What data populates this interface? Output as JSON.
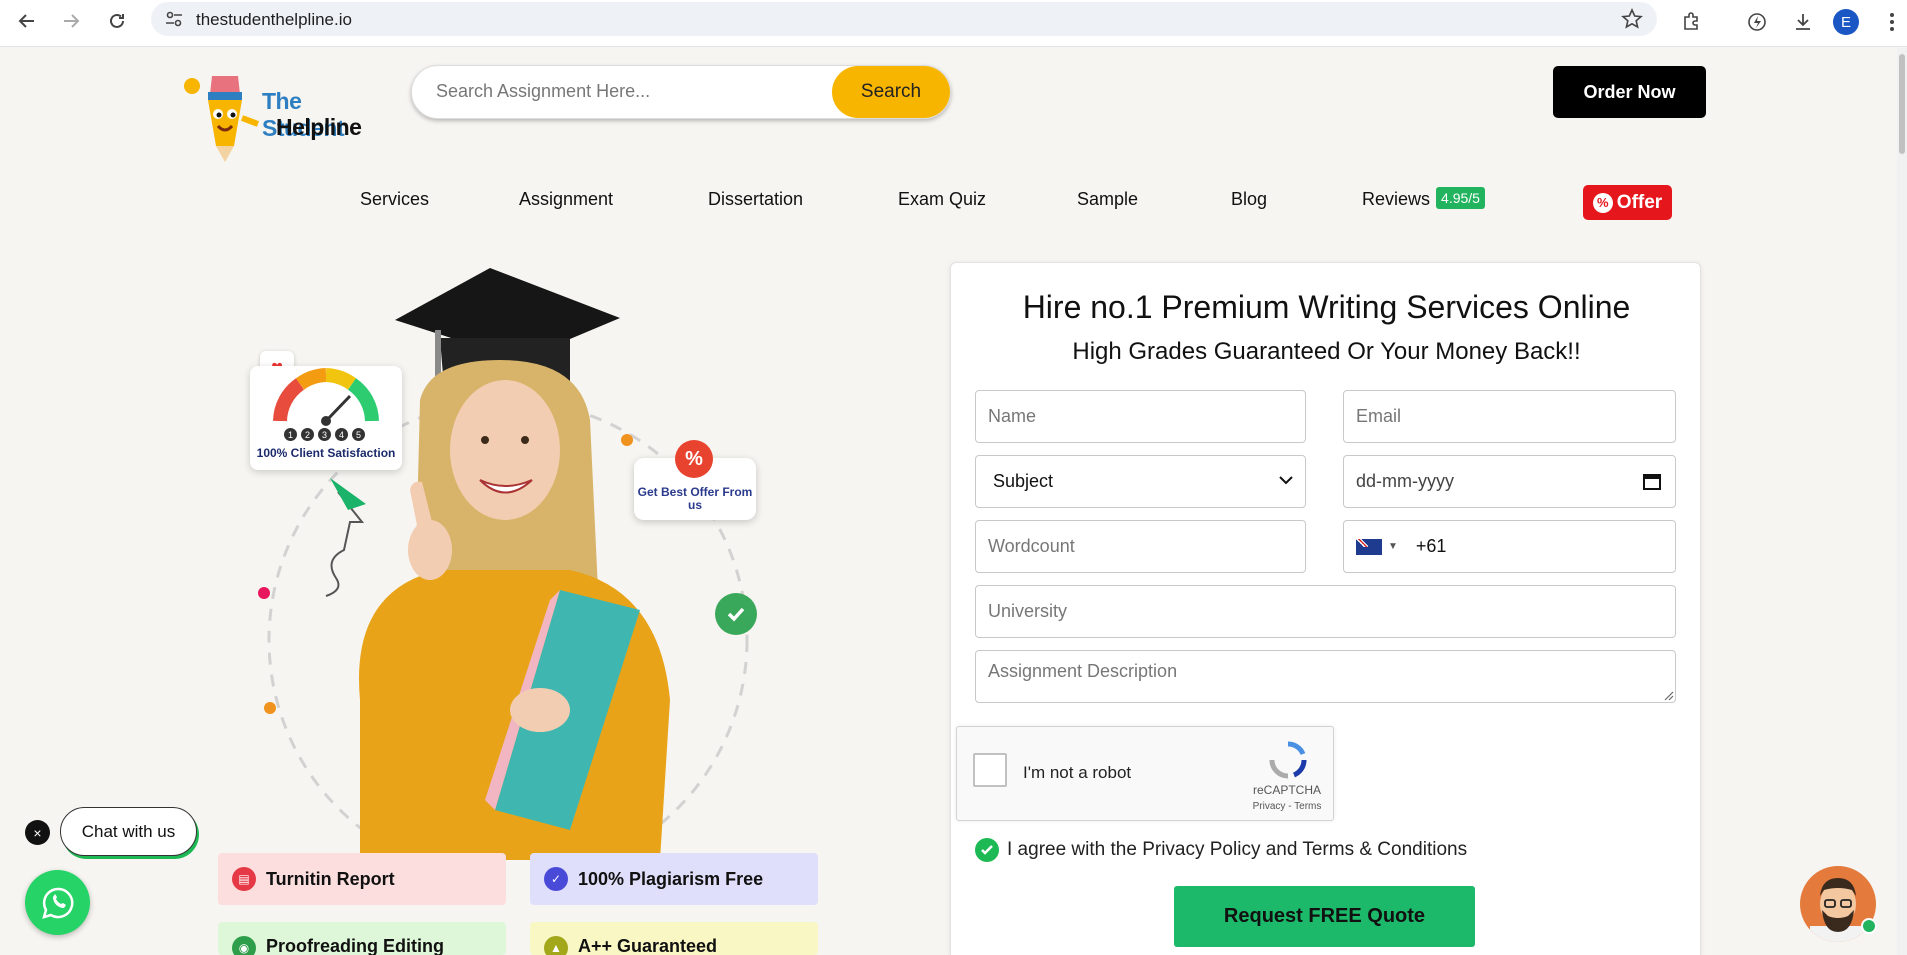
{
  "browser": {
    "url": "thestudenthelpline.io",
    "profile_initial": "E",
    "icons": [
      "back-icon",
      "forward-icon",
      "reload-icon",
      "site-settings-icon",
      "star-icon",
      "extensions-icon",
      "performance-icon",
      "downloads-icon",
      "menu-icon"
    ]
  },
  "header": {
    "logo_line1": "The Student",
    "logo_line2": "Helpline",
    "search_placeholder": "Search Assignment Here...",
    "search_label": "Search",
    "order_label": "Order Now"
  },
  "nav": {
    "items": [
      "Services",
      "Assignment",
      "Dissertation",
      "Exam Quiz",
      "Sample",
      "Blog",
      "Reviews"
    ],
    "rating": "4.95/5",
    "offer_label": "Offer",
    "offer_icon": "%"
  },
  "hero": {
    "satisfaction_label": "100% Client Satisfaction",
    "meter_digits": [
      "1",
      "2",
      "3",
      "4",
      "5"
    ],
    "offer_card_label": "Get Best Offer From us",
    "offer_badge": "%",
    "features": [
      {
        "label": "Turnitin Report",
        "bg": "#fcdede",
        "icon": "#e53945"
      },
      {
        "label": "100% Plagiarism Free",
        "bg": "#dfdffb",
        "icon": "#4a4ad8"
      },
      {
        "label": "Proofreading Editing",
        "bg": "#def7d9",
        "icon": "#2f9e4a"
      },
      {
        "label": "A++ Guaranteed",
        "bg": "#f9f7c4",
        "icon": "#a2a81a"
      }
    ]
  },
  "chat": {
    "close": "×",
    "label": "Chat with us"
  },
  "form": {
    "title": "Hire no.1 Premium Writing Services Online",
    "subtitle": "High Grades Guaranteed Or Your Money Back!!",
    "name_placeholder": "Name",
    "email_placeholder": "Email",
    "subject_value": "Subject",
    "date_value": "dd-mm-yyyy",
    "wordcount_placeholder": "Wordcount",
    "phone_code": "+61",
    "university_placeholder": "University",
    "description_placeholder": "Assignment Description",
    "captcha_label": "I'm not a robot",
    "captcha_brand": "reCAPTCHA",
    "captcha_terms": "Privacy - Terms",
    "agree_text": "I agree with the Privacy Policy and Terms & Conditions",
    "submit_label": "Request FREE Quote"
  },
  "colors": {
    "accent_yellow": "#f7b500",
    "accent_green": "#1db96a",
    "offer_red": "#e5161c",
    "rating_green": "#22b35e"
  }
}
